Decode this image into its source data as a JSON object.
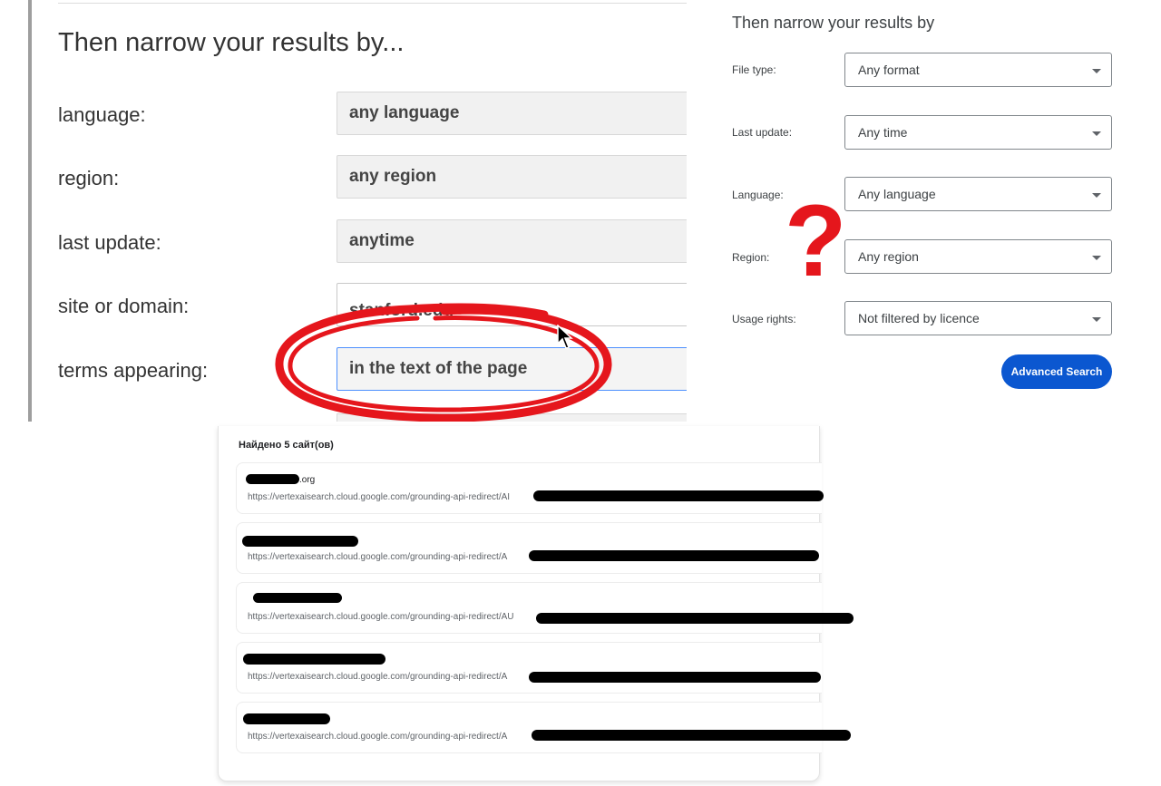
{
  "old_search": {
    "heading": "Then narrow your results by...",
    "rows": [
      {
        "label": "language:",
        "value": "any language"
      },
      {
        "label": "region:",
        "value": "any region"
      },
      {
        "label": "last update:",
        "value": "anytime"
      },
      {
        "label": "site or domain:",
        "value": "stanford.edu"
      },
      {
        "label": "terms appearing:",
        "value": "in the text of the page"
      }
    ]
  },
  "new_search": {
    "heading": "Then narrow your results by",
    "rows": [
      {
        "label": "File type:",
        "value": "Any format"
      },
      {
        "label": "Last update:",
        "value": "Any time"
      },
      {
        "label": "Language:",
        "value": "Any language"
      },
      {
        "label": "Region:",
        "value": "Any region"
      },
      {
        "label": "Usage rights:",
        "value": "Not filtered by licence"
      }
    ],
    "button_label": "Advanced Search"
  },
  "annotations": {
    "question_mark": "?",
    "circle_color": "#e5161c"
  },
  "results": {
    "count_text": "Найдено 5 сайт(ов)",
    "items": [
      {
        "name_suffix": ".org",
        "url": "https://vertexaisearch.cloud.google.com/grounding-api-redirect/AI"
      },
      {
        "name_suffix": "",
        "url": "https://vertexaisearch.cloud.google.com/grounding-api-redirect/A"
      },
      {
        "name_suffix": "",
        "url": "https://vertexaisearch.cloud.google.com/grounding-api-redirect/AU"
      },
      {
        "name_suffix": "",
        "url": "https://vertexaisearch.cloud.google.com/grounding-api-redirect/A"
      },
      {
        "name_suffix": "",
        "url": "https://vertexaisearch.cloud.google.com/grounding-api-redirect/A"
      }
    ]
  },
  "colors": {
    "accent_button": "#0b57d0",
    "annotation_red": "#e5161c",
    "focus_border": "#4d90fe"
  }
}
